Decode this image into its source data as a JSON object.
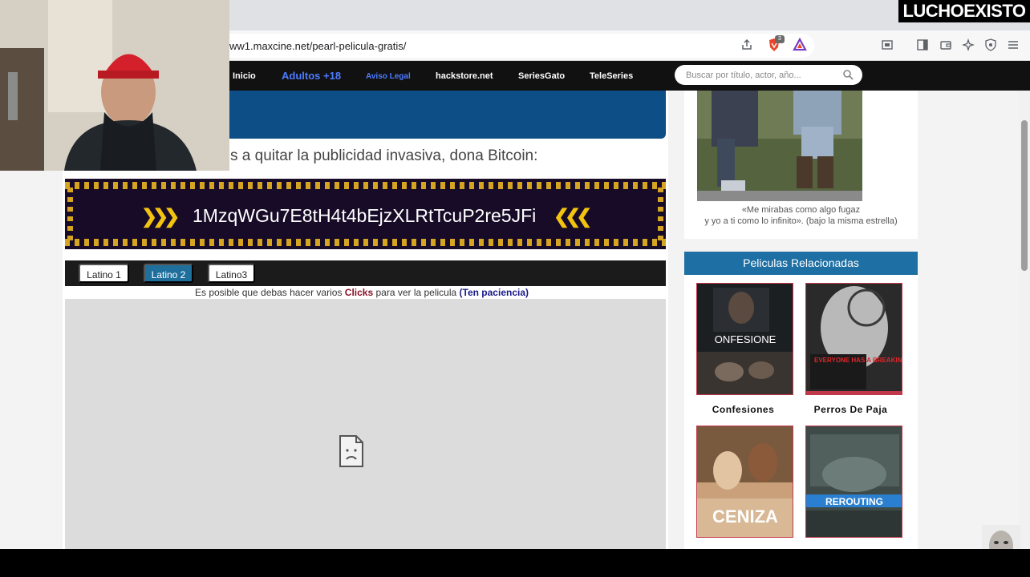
{
  "browser": {
    "url": "ww1.maxcine.net/pearl-pelicula-gratis/",
    "brave_shield_count": "3"
  },
  "nav": {
    "items": [
      "Inicio",
      "Adultos +18",
      "Aviso Legal",
      "hackstore.net",
      "SeriesGato",
      "TeleSeries"
    ],
    "search_placeholder": "Buscar por título, actor, año..."
  },
  "main": {
    "donate_text": "s a quitar la publicidad invasiva, dona Bitcoin:",
    "bitcoin_address": "1MzqWGu7E8tH4t4bEjzXLRtTcuP2re5JFi",
    "player_tabs": [
      "Latino 1",
      "Latino 2",
      "Latino3"
    ],
    "hint": {
      "prefix": "Es posible que debas hacer varios ",
      "clicks": "Clicks",
      "middle": " para ver la pelicula ",
      "paciencia": "(Ten paciencia)"
    }
  },
  "sidebar": {
    "quote_line1": "«Me mirabas como algo fugaz",
    "quote_line2": "y yo a ti como lo infinito». (bajo la misma estrella)",
    "related_title": "Peliculas Relacionadas",
    "movies": [
      {
        "title": "Confesiones",
        "poster_text": "ONFESIONE"
      },
      {
        "title": "Perros De Paja",
        "poster_text": "EVERYONE HAS A BREAKING POINT"
      },
      {
        "title": "",
        "poster_text": "CENIZA"
      },
      {
        "title": "",
        "poster_text": "REROUTING"
      }
    ]
  },
  "overlay": {
    "watermark": "LUCHOEXISTO"
  },
  "colors": {
    "nav_bg": "#111111",
    "accent_blue": "#1e6fa3",
    "bitcoin_gold": "#d5a521",
    "clicks_red": "#8a1026"
  }
}
